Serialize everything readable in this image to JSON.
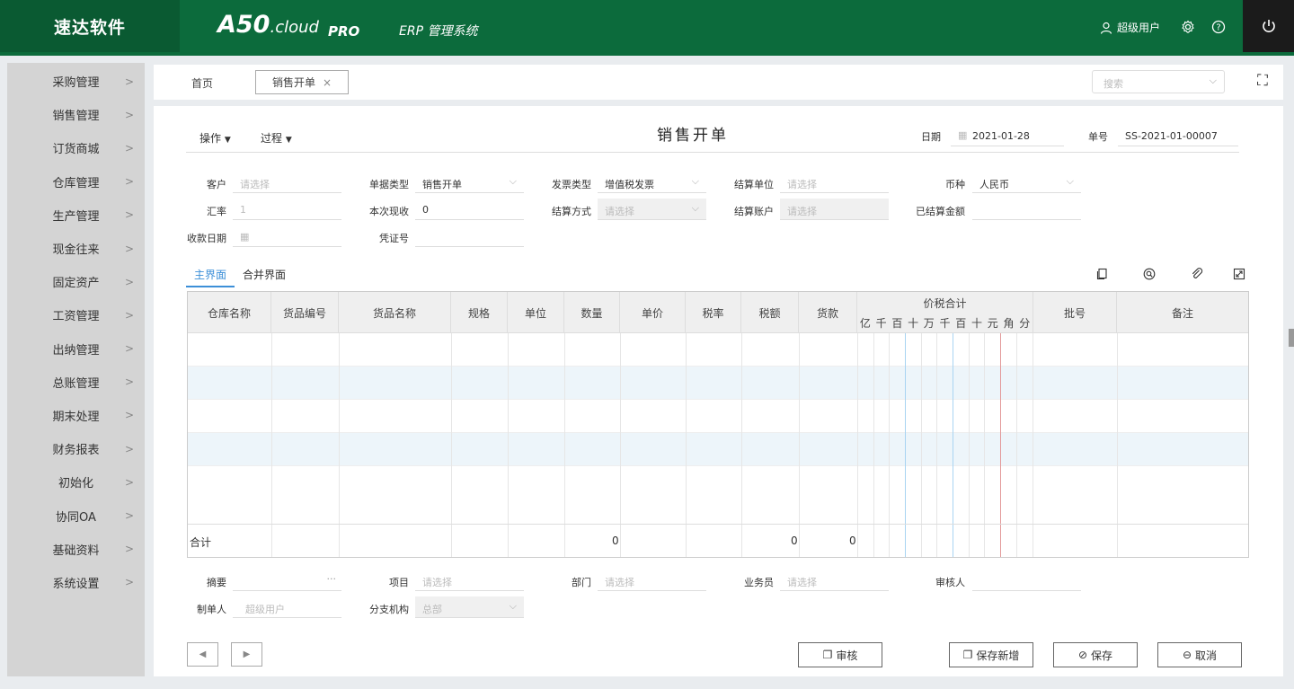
{
  "header": {
    "brand": "速达软件",
    "logo_main": "A50",
    "logo_sub": ".cloud",
    "edition": "PRO",
    "system_name": "ERP 管理系统",
    "user_name": "超级用户"
  },
  "sidebar": {
    "items": [
      {
        "label": "采购管理"
      },
      {
        "label": "销售管理"
      },
      {
        "label": "订货商城"
      },
      {
        "label": "仓库管理"
      },
      {
        "label": "生产管理"
      },
      {
        "label": "现金往来"
      },
      {
        "label": "固定资产"
      },
      {
        "label": "工资管理"
      },
      {
        "label": "出纳管理"
      },
      {
        "label": "总账管理"
      },
      {
        "label": "期末处理"
      },
      {
        "label": "财务报表"
      },
      {
        "label": "初始化"
      },
      {
        "label": "协同OA"
      },
      {
        "label": "基础资料"
      },
      {
        "label": "系统设置"
      }
    ]
  },
  "tabbar": {
    "home": "首页",
    "active_tab": "销售开单",
    "close": "×",
    "search_placeholder": "搜索"
  },
  "form": {
    "op_menu": "操作",
    "process_menu": "过程",
    "title": "销售开单",
    "date_label": "日期",
    "date_value": "2021-01-28",
    "doc_no_label": "单号",
    "doc_no_value": "SS-2021-01-00007",
    "customer_label": "客户",
    "customer_ph": "请选择",
    "doc_type_label": "单据类型",
    "doc_type_value": "销售开单",
    "invoice_type_label": "发票类型",
    "invoice_type_value": "增值税发票",
    "settle_unit_label": "结算单位",
    "settle_unit_ph": "请选择",
    "currency_label": "币种",
    "currency_value": "人民币",
    "rate_label": "汇率",
    "rate_value": "1",
    "cash_label": "本次现收",
    "cash_value": "0",
    "settle_method_label": "结算方式",
    "settle_method_ph": "请选择",
    "settle_account_label": "结算账户",
    "settle_account_ph": "请选择",
    "settled_amount_label": "已结算金额",
    "collect_date_label": "收款日期",
    "voucher_label": "凭证号"
  },
  "tabs": {
    "main": "主界面",
    "merge": "合并界面"
  },
  "grid": {
    "columns": [
      "仓库名称",
      "货品编号",
      "货品名称",
      "规格",
      "单位",
      "数量",
      "单价",
      "税率",
      "税额",
      "货款"
    ],
    "price_total_title": "价税合计",
    "price_digits": [
      "亿",
      "千",
      "百",
      "十",
      "万",
      "千",
      "百",
      "十",
      "元",
      "角",
      "分"
    ],
    "batch_col": "批号",
    "remark_col": "备注",
    "sum_label": "合计",
    "sum_qty": "0",
    "sum_tax": "0",
    "sum_amount": "0"
  },
  "footer": {
    "summary_label": "摘要",
    "summary_more": "···",
    "project_label": "项目",
    "project_ph": "请选择",
    "dept_label": "部门",
    "dept_ph": "请选择",
    "salesman_label": "业务员",
    "salesman_ph": "请选择",
    "auditor_label": "审核人",
    "maker_label": "制单人",
    "maker_value": "超级用户",
    "branch_label": "分支机构",
    "branch_value": "总部",
    "prev": "◀",
    "next": "▶",
    "audit_btn": "审核",
    "save_new_btn": "保存新增",
    "save_btn": "保存",
    "cancel_btn": "取消"
  }
}
